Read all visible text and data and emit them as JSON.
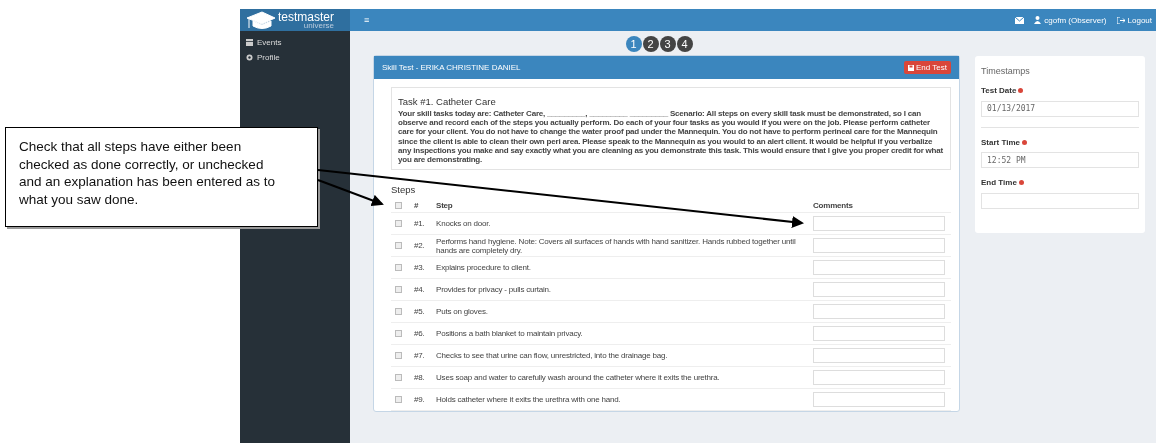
{
  "callout": {
    "text": "Check that all steps have either been checked as done correctly, or unchecked and an explanation has been entered as to what you saw done."
  },
  "header": {
    "logo": "testmaster",
    "logo_sub": "universe",
    "menu_icon": "≡",
    "user": "cgofm (Observer)",
    "logout": "Logout"
  },
  "sidebar": {
    "items": [
      {
        "label": "Events",
        "kind": "calendar"
      },
      {
        "label": "Profile",
        "kind": "gear"
      }
    ]
  },
  "stepper": [
    {
      "label": "1",
      "selected": true
    },
    {
      "label": "2",
      "selected": false
    },
    {
      "label": "3",
      "selected": false
    },
    {
      "label": "4",
      "selected": false
    }
  ],
  "panel": {
    "title": "Skill Test - ERIKA CHRISTINE DANIEL",
    "end_button": "End Test",
    "task_title": "Task #1. Catheter Care",
    "task_text": "Your skill tasks today are: Catheter Care, _________, _________ _________ Scenario: All steps on every skill task must be demonstrated, so I can observe and record each of the steps you actually perform. Do each of your four tasks as you would if you were on the job. Please perform catheter care for your client. You do not have to change the water proof pad under the Mannequin. You do not have to perform perineal care for the Mannequin since the client is able to clean their own peri area. Please speak to the Mannequin as you would to an alert client. It would be helpful if you verbalize any inspections you make and say exactly what you are cleaning as you demonstrate this task. This would ensure that I give you proper credit for what you are demonstrating.",
    "steps_title": "Steps",
    "columns": [
      "#",
      "Step",
      "Comments"
    ],
    "all_checked": false,
    "rows": [
      {
        "num": "#1.",
        "step": "Knocks on door.",
        "checked": false
      },
      {
        "num": "#2.",
        "step": "Performs hand hygiene. Note: Covers all surfaces of hands with hand sanitizer. Hands rubbed together until hands are completely dry.",
        "checked": false
      },
      {
        "num": "#3.",
        "step": "Explains procedure to client.",
        "checked": false
      },
      {
        "num": "#4.",
        "step": "Provides for privacy - pulls curtain.",
        "checked": false
      },
      {
        "num": "#5.",
        "step": "Puts on gloves.",
        "checked": false
      },
      {
        "num": "#6.",
        "step": "Positions a bath blanket to maintain privacy.",
        "checked": false
      },
      {
        "num": "#7.",
        "step": "Checks to see that urine can flow, unrestricted, into the drainage bag.",
        "checked": false
      },
      {
        "num": "#8.",
        "step": "Uses soap and water to carefully wash around the catheter where it exits the urethra.",
        "checked": false
      },
      {
        "num": "#9.",
        "step": "Holds catheter where it exits the urethra with one hand.",
        "checked": false
      }
    ]
  },
  "timestamps": {
    "title": "Timestamps",
    "fields": [
      {
        "label": "Test Date",
        "value": "01/13/2017",
        "required": true
      },
      {
        "label": "Start Time",
        "value": "12:52 PM",
        "required": true
      },
      {
        "label": "End Time",
        "required": true
      }
    ]
  }
}
